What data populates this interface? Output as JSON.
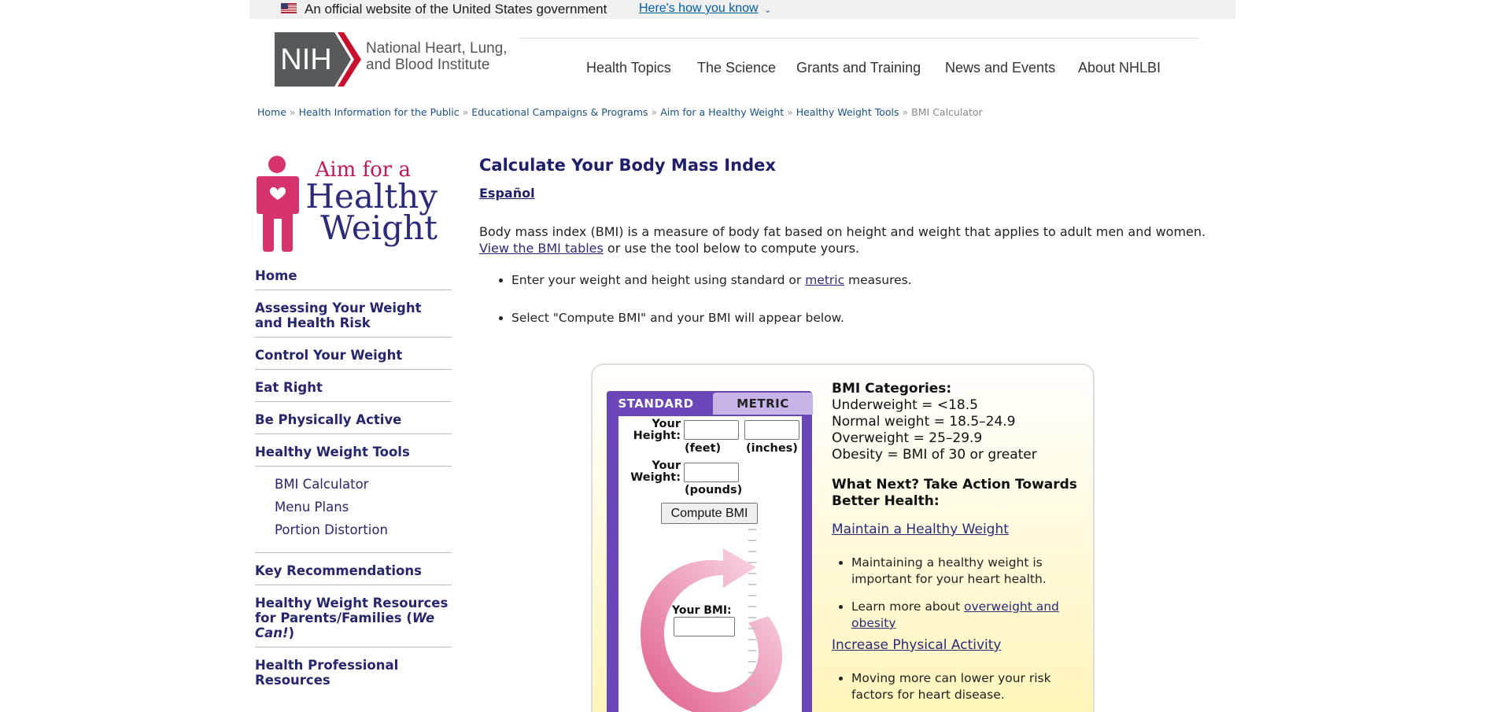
{
  "gov_banner": {
    "text": "An official website of the United States government",
    "link": "Here's how you know"
  },
  "header": {
    "logo_text": "NIH",
    "institute_line1": "National Heart, Lung,",
    "institute_line2": "and Blood Institute",
    "nav": [
      "Health Topics",
      "The Science",
      "Grants and Training",
      "News and Events",
      "About NHLBI"
    ]
  },
  "breadcrumb": {
    "items": [
      "Home",
      "Health Information for the Public",
      "Educational Campaigns & Programs",
      "Aim for a Healthy Weight",
      "Healthy Weight Tools"
    ],
    "current": "BMI Calculator"
  },
  "sidebar": {
    "logo_line1": "Aim for a",
    "logo_line2": "Healthy",
    "logo_line3": "Weight",
    "items_top": [
      "Home",
      "Assessing Your Weight and Health Risk",
      "Control Your Weight",
      "Eat Right",
      "Be Physically Active",
      "Healthy Weight Tools"
    ],
    "sub_items": [
      "BMI Calculator",
      "Menu Plans",
      "Portion Distortion"
    ],
    "key_recommendations": "Key Recommendations",
    "parents_resources": "Healthy Weight Resources for Parents/Families (",
    "we_can": "We Can!",
    "parents_close": ")",
    "professional_resources": "Health Professional Resources"
  },
  "main": {
    "title": "Calculate Your Body Mass Index",
    "espanol": "Español",
    "intro_text": "Body mass index (BMI) is a measure of body fat based on height and weight that applies to adult men and women.",
    "intro_link": "View the BMI tables",
    "intro_tail": " or use the tool below to compute yours.",
    "bullet1_pre": "Enter your weight and height using standard or ",
    "bullet1_link": "metric",
    "bullet1_post": " measures.",
    "bullet2": "Select \"Compute BMI\" and your BMI will appear below."
  },
  "calculator": {
    "tab_standard": "STANDARD",
    "tab_metric": "METRIC",
    "height_label_1": "Your",
    "height_label_2": "Height:",
    "feet_unit": "(feet)",
    "inches_unit": "(inches)",
    "weight_label_1": "Your",
    "weight_label_2": "Weight:",
    "pounds_unit": "(pounds)",
    "feet_value": "",
    "inches_value": "",
    "pounds_value": "",
    "compute_button": "Compute BMI",
    "your_bmi_label": "Your BMI:",
    "bmi_value": ""
  },
  "categories": {
    "title": "BMI Categories:",
    "lines": [
      "Underweight = <18.5",
      "Normal weight = 18.5–24.9",
      "Overweight = 25–29.9",
      "Obesity = BMI of 30 or greater"
    ],
    "next_title": "What Next? Take Action Towards Better Health:",
    "link1": "Maintain a Healthy Weight",
    "bullet1": "Maintaining a healthy weight is important for your heart health.",
    "bullet2_pre": "Learn more about ",
    "bullet2_link": "overweight and obesity",
    "link2": "Increase Physical Activity",
    "bullet3": "Moving more can lower your risk factors for heart disease."
  },
  "colors": {
    "accent_purple": "#6b46b8",
    "metric_tab": "#c8b4e6",
    "navy_text": "#26266e",
    "arrow_pink": "#e05a8a",
    "nih_red": "#c8102e"
  }
}
